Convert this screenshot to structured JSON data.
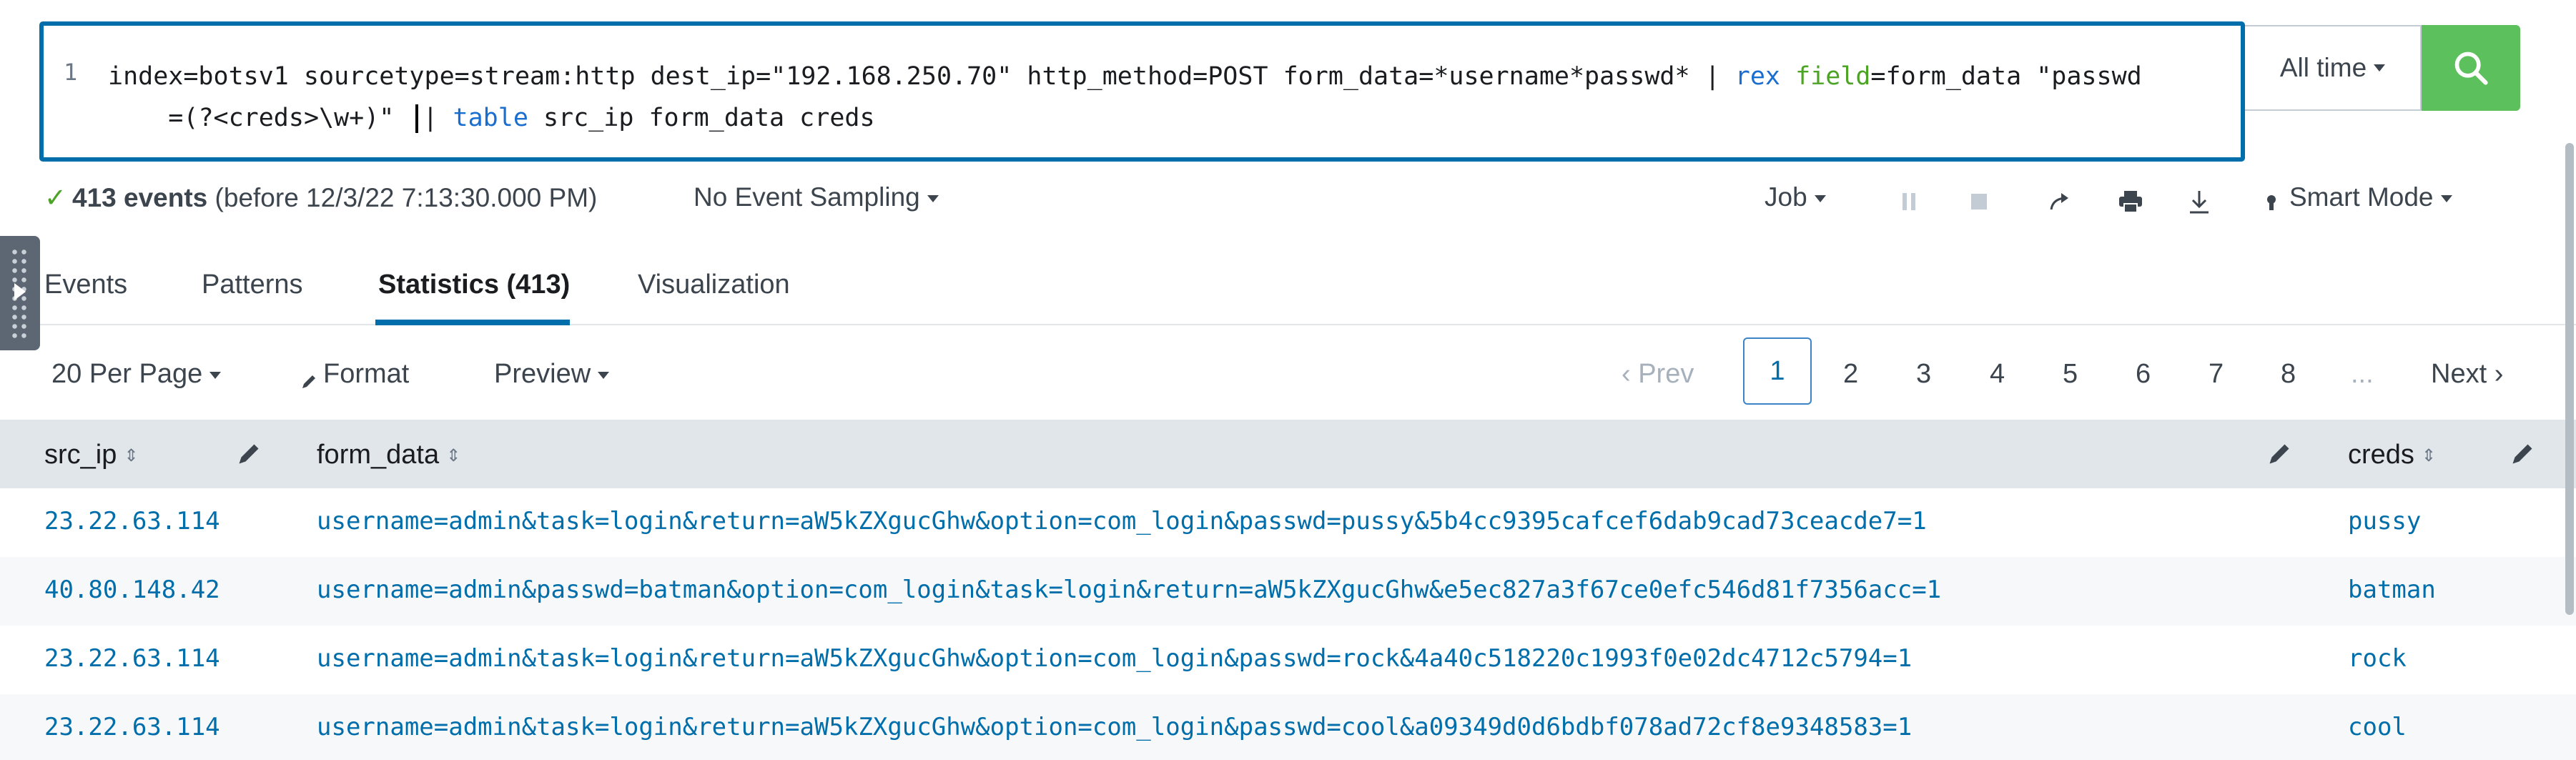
{
  "search": {
    "line_number": "1",
    "query_line1_prefix": "index=botsv1 sourcetype=stream:http dest_ip=\"192.168.250.70\" http_method=POST form_data=*username*passwd* | ",
    "query_rex": "rex",
    "query_field": "field",
    "query_line1_suffix": "=form_data \"passwd",
    "query_line2_prefix": "    =(?<creds>\\w+)\"",
    "query_pipe": "| ",
    "query_table": "table",
    "query_line2_suffix": " src_ip form_data creds",
    "time_range": "All time",
    "search_button_icon": "search-icon"
  },
  "status": {
    "count": "413 events",
    "detail": "(before 12/3/22 7:13:30.000 PM)",
    "sampling": "No Event Sampling",
    "job": "Job",
    "mode": "Smart Mode"
  },
  "tabs": [
    {
      "label": "Events"
    },
    {
      "label": "Patterns"
    },
    {
      "label": "Statistics (413)"
    },
    {
      "label": "Visualization"
    }
  ],
  "controls": {
    "per_page": "20 Per Page",
    "format": "Format",
    "preview": "Preview"
  },
  "pagination": {
    "prev": "‹ Prev",
    "pages": [
      "1",
      "2",
      "3",
      "4",
      "5",
      "6",
      "7",
      "8"
    ],
    "ellipsis": "...",
    "next": "Next ›",
    "current": "1"
  },
  "table": {
    "columns": [
      "src_ip",
      "form_data",
      "creds"
    ],
    "rows": [
      [
        "23.22.63.114",
        "username=admin&task=login&return=aW5kZXgucGhw&option=com_login&passwd=pussy&5b4cc9395cafcef6dab9cad73ceacde7=1",
        "pussy"
      ],
      [
        "40.80.148.42",
        "username=admin&passwd=batman&option=com_login&task=login&return=aW5kZXgucGhw&e5ec827a3f67ce0efc546d81f7356acc=1",
        "batman"
      ],
      [
        "23.22.63.114",
        "username=admin&task=login&return=aW5kZXgucGhw&option=com_login&passwd=rock&4a40c518220c1993f0e02dc4712c5794=1",
        "rock"
      ],
      [
        "23.22.63.114",
        "username=admin&task=login&return=aW5kZXgucGhw&option=com_login&passwd=cool&a09349d0d6bdbf078ad72cf8e9348583=1",
        "cool"
      ]
    ]
  },
  "colors": {
    "accent": "#006eaa",
    "search_button": "#5cc05c",
    "success": "#4ca326",
    "header_bg": "#e1e6eb"
  }
}
